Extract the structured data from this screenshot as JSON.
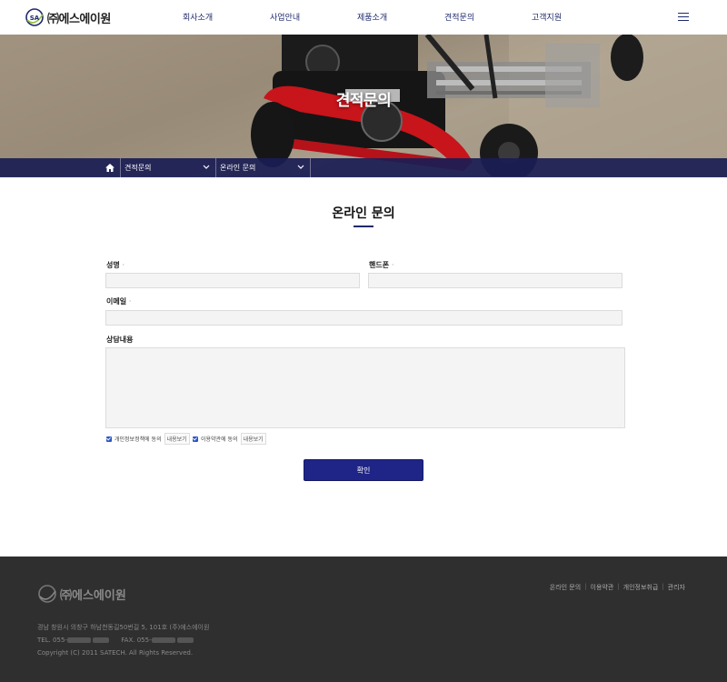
{
  "header": {
    "logo_badge": "SA",
    "logo_text": "㈜에스에이원",
    "nav": [
      "회사소개",
      "사업안내",
      "제품소개",
      "견적문의",
      "고객지원"
    ]
  },
  "hero": {
    "title": "견적문의"
  },
  "breadcrumb": {
    "level1": "견적문의",
    "level2": "온라인 문의"
  },
  "page": {
    "heading": "온라인 문의"
  },
  "form": {
    "name_label": "성명",
    "phone_label": "핸드폰",
    "email_label": "이메일",
    "content_label": "상담내용",
    "required_mark": "·",
    "agree_privacy": "개인정보정책에 동의",
    "agree_terms": "이용약관에 동의",
    "view_label": "내용보기",
    "submit_label": "확인"
  },
  "footer": {
    "logo_text": "㈜에스에이원",
    "links": [
      "온라인 문의",
      "이용약관",
      "개인정보취급",
      "관리자"
    ],
    "address": "경남 창원시 의창구 하남천동길50번길 5, 101호 (주)에스에이원",
    "tel_label": "TEL. 055-",
    "fax_label": "FAX. 055-",
    "copyright": "Copyright (C) 2011 SATECH. All Rights Reserved."
  },
  "colors": {
    "brand": "#1f2586",
    "nav_text": "#1f2a6b",
    "footer_bg": "#2f2f2f"
  }
}
